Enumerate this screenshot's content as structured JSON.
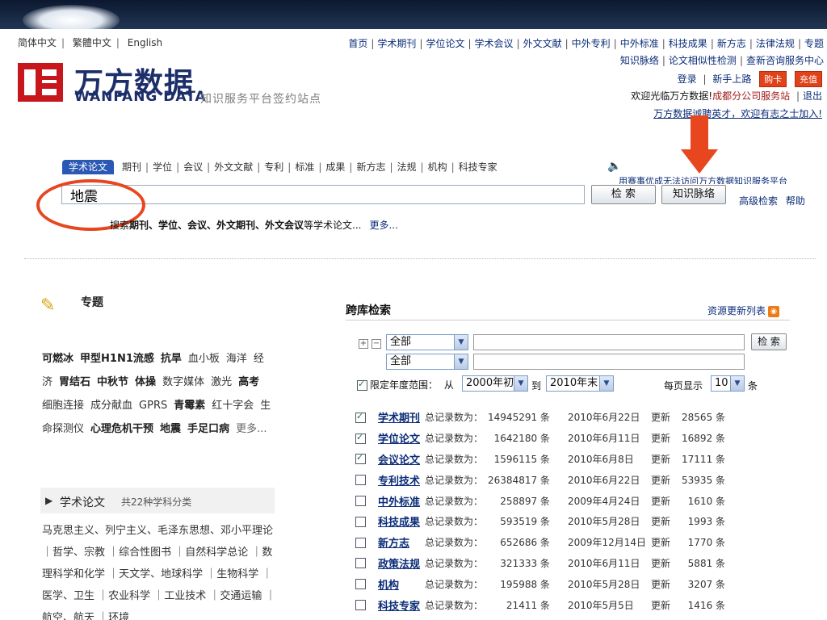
{
  "language": [
    "简体中文",
    "繁體中文",
    "English"
  ],
  "top_nav": [
    "首页",
    "学术期刊",
    "学位论文",
    "学术会议",
    "外文文献",
    "中外专利",
    "中外标准",
    "科技成果",
    "新方志",
    "法律法规",
    "专题"
  ],
  "top_nav2": [
    "知识脉络",
    "论文相似性检测",
    "查新咨询服务中心"
  ],
  "account": {
    "login": "登录",
    "newbie": "新手上路",
    "buy_card": "购卡",
    "recharge": "充值"
  },
  "welcome": {
    "text": "欢迎光临万方数据!",
    "branch": "成都分公司服务站",
    "logout": "退出"
  },
  "recruit": "万方数据诚聘英才，欢迎有志之士加入!",
  "logo": {
    "cn": "万方数据",
    "en": "WANFANG DATA",
    "tagline": "知识服务平台签约站点"
  },
  "search": {
    "tabs": [
      "学术论文",
      "期刊",
      "学位",
      "会议",
      "外文文献",
      "专利",
      "标准",
      "成果",
      "新方志",
      "法规",
      "机构",
      "科技专家"
    ],
    "notice": "用赛事优成无法访问万方数据知识服务平台",
    "query": "地震",
    "search_button": "检 索",
    "knowledge_button": "知识脉络",
    "advanced": "高级检索",
    "help": "帮助",
    "hint_prefix": "搜索",
    "hint_bold": "期刊、学位、会议、外文期刊、外文会议",
    "hint_suffix": "等学术论文...",
    "more": "更多..."
  },
  "special": {
    "title": "专题",
    "topics": [
      {
        "t": "可燃冰",
        "b": true
      },
      {
        "t": "甲型H1N1流感",
        "b": true
      },
      {
        "t": "抗旱",
        "b": true
      },
      {
        "t": "血小板",
        "b": false
      },
      {
        "t": "海洋",
        "b": false
      },
      {
        "t": "经济",
        "b": false
      },
      {
        "t": "胃结石",
        "b": true
      },
      {
        "t": "中秋节",
        "b": true
      },
      {
        "t": "体操",
        "b": true
      },
      {
        "t": "数字媒体",
        "b": false
      },
      {
        "t": "激光",
        "b": false
      },
      {
        "t": "高考",
        "b": true
      },
      {
        "t": "细胞连接",
        "b": false
      },
      {
        "t": "成分献血",
        "b": false
      },
      {
        "t": "GPRS",
        "b": false
      },
      {
        "t": "青霉素",
        "b": true
      },
      {
        "t": "红十字会",
        "b": false
      },
      {
        "t": "生命探测仪",
        "b": false
      },
      {
        "t": "心理危机干预",
        "b": true
      },
      {
        "t": "地震",
        "b": true
      },
      {
        "t": "手足口病",
        "b": true
      }
    ],
    "more": "更多..."
  },
  "subjects": {
    "title": "学术论文",
    "subtitle": "共22种学科分类",
    "text": "马克思主义、列宁主义、毛泽东思想、邓小平理论 ｜哲学、宗教 ｜综合性图书 ｜自然科学总论 ｜数理科学和化学 ｜天文学、地球科学 ｜生物科学 ｜医学、卫生 ｜农业科学 ｜工业技术 ｜交通运输 ｜航空、航天 ｜环境"
  },
  "cross": {
    "title": "跨库检索",
    "rss": "资源更新列表",
    "field1": "全部",
    "field2": "全部",
    "search_button": "检 索",
    "year_label": "限定年度范围：",
    "from_label": "从",
    "from": "2000年初",
    "to_label": "到",
    "to": "2010年末",
    "per_page_label": "每页显示",
    "per_page": "10",
    "per_page_unit": "条",
    "rows": [
      {
        "checked": true,
        "name": "学术期刊",
        "label": "总记录数为：",
        "total": "14945291",
        "unit": "条",
        "date": "2010年6月22日",
        "upd": "更新",
        "count": "28565"
      },
      {
        "checked": true,
        "name": "学位论文",
        "label": "总记录数为：",
        "total": "1642180",
        "unit": "条",
        "date": "2010年6月11日",
        "upd": "更新",
        "count": "16892"
      },
      {
        "checked": true,
        "name": "会议论文",
        "label": "总记录数为：",
        "total": "1596115",
        "unit": "条",
        "date": "2010年6月8日",
        "upd": "更新",
        "count": "17111"
      },
      {
        "checked": false,
        "name": "专利技术",
        "label": "总记录数为：",
        "total": "26384817",
        "unit": "条",
        "date": "2010年6月22日",
        "upd": "更新",
        "count": "53935"
      },
      {
        "checked": false,
        "name": "中外标准",
        "label": "总记录数为：",
        "total": "258897",
        "unit": "条",
        "date": "2009年4月24日",
        "upd": "更新",
        "count": "1610"
      },
      {
        "checked": false,
        "name": "科技成果",
        "label": "总记录数为：",
        "total": "593519",
        "unit": "条",
        "date": "2010年5月28日",
        "upd": "更新",
        "count": "1993"
      },
      {
        "checked": false,
        "name": "新方志",
        "label": "总记录数为：",
        "total": "652686",
        "unit": "条",
        "date": "2009年12月14日",
        "upd": "更新",
        "count": "1770"
      },
      {
        "checked": false,
        "name": "政策法规",
        "label": "总记录数为：",
        "total": "321333",
        "unit": "条",
        "date": "2010年6月11日",
        "upd": "更新",
        "count": "5881"
      },
      {
        "checked": false,
        "name": "机构",
        "label": "总记录数为：",
        "total": "195988",
        "unit": "条",
        "date": "2010年5月28日",
        "upd": "更新",
        "count": "3207"
      },
      {
        "checked": false,
        "name": "科技专家",
        "label": "总记录数为：",
        "total": "21411",
        "unit": "条",
        "date": "2010年5月5日",
        "upd": "更新",
        "count": "1416"
      }
    ]
  },
  "colors": {
    "annotation": "#e8461f",
    "link": "#0b2c78",
    "logo": "#c8161d"
  }
}
